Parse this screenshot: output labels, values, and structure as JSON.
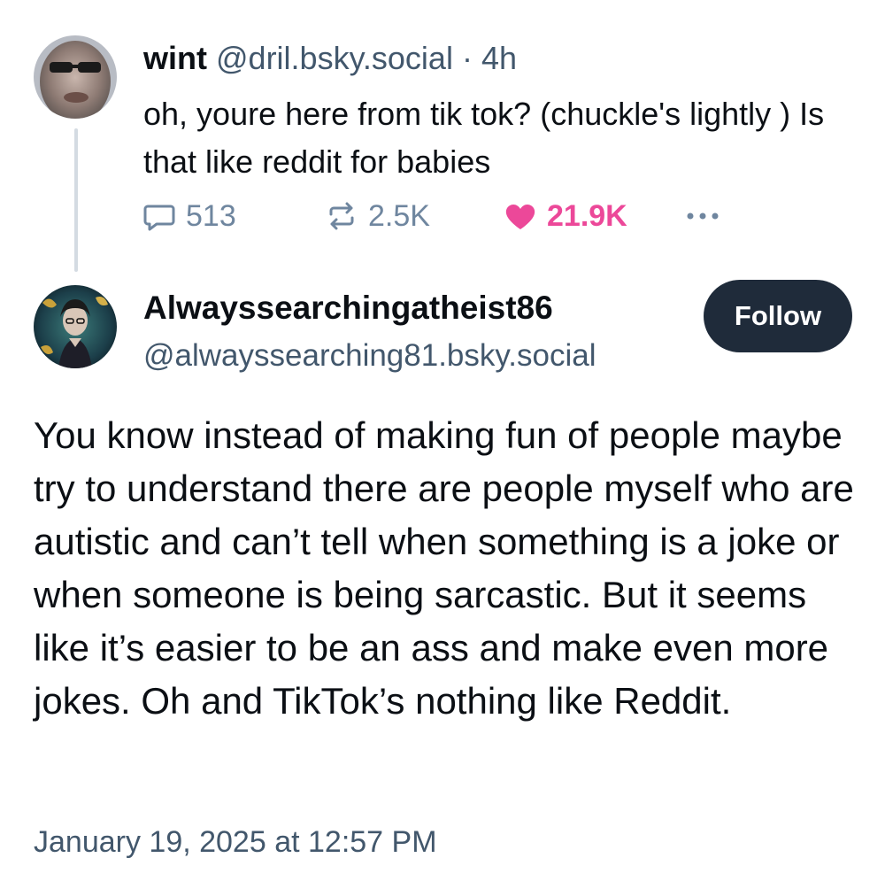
{
  "parent_post": {
    "display_name": "wint",
    "handle": "@dril.bsky.social",
    "separator": " · ",
    "age": "4h",
    "text": "oh, youre here from tik tok?  (chuckle's lightly ) Is that like reddit for babies",
    "stats": {
      "replies": "513",
      "reposts": "2.5K",
      "likes": "21.9K"
    },
    "icons": {
      "reply": "reply-bubble-icon",
      "repost": "repost-arrows-icon",
      "like": "heart-icon",
      "more": "more-dots-icon"
    },
    "like_color": "#ec4899"
  },
  "reply_post": {
    "display_name": "Alwayssearchingatheist86",
    "handle": "@alwayssearching81.bsky.social",
    "follow_label": "Follow",
    "text": "You know instead of making fun of people maybe try to understand there are people myself who are autistic and can’t tell when something is a joke or when someone is being sarcastic. But it seems like it’s easier to be an ass and make even more jokes. Oh and TikTok’s nothing like Reddit.",
    "timestamp": "January 19, 2025 at 12:57 PM"
  },
  "colors": {
    "text": "#0b0f14",
    "muted": "#42576c",
    "icon": "#6f869f",
    "follow_bg": "#1f2b3a",
    "thread_line": "#d4dbe2"
  }
}
